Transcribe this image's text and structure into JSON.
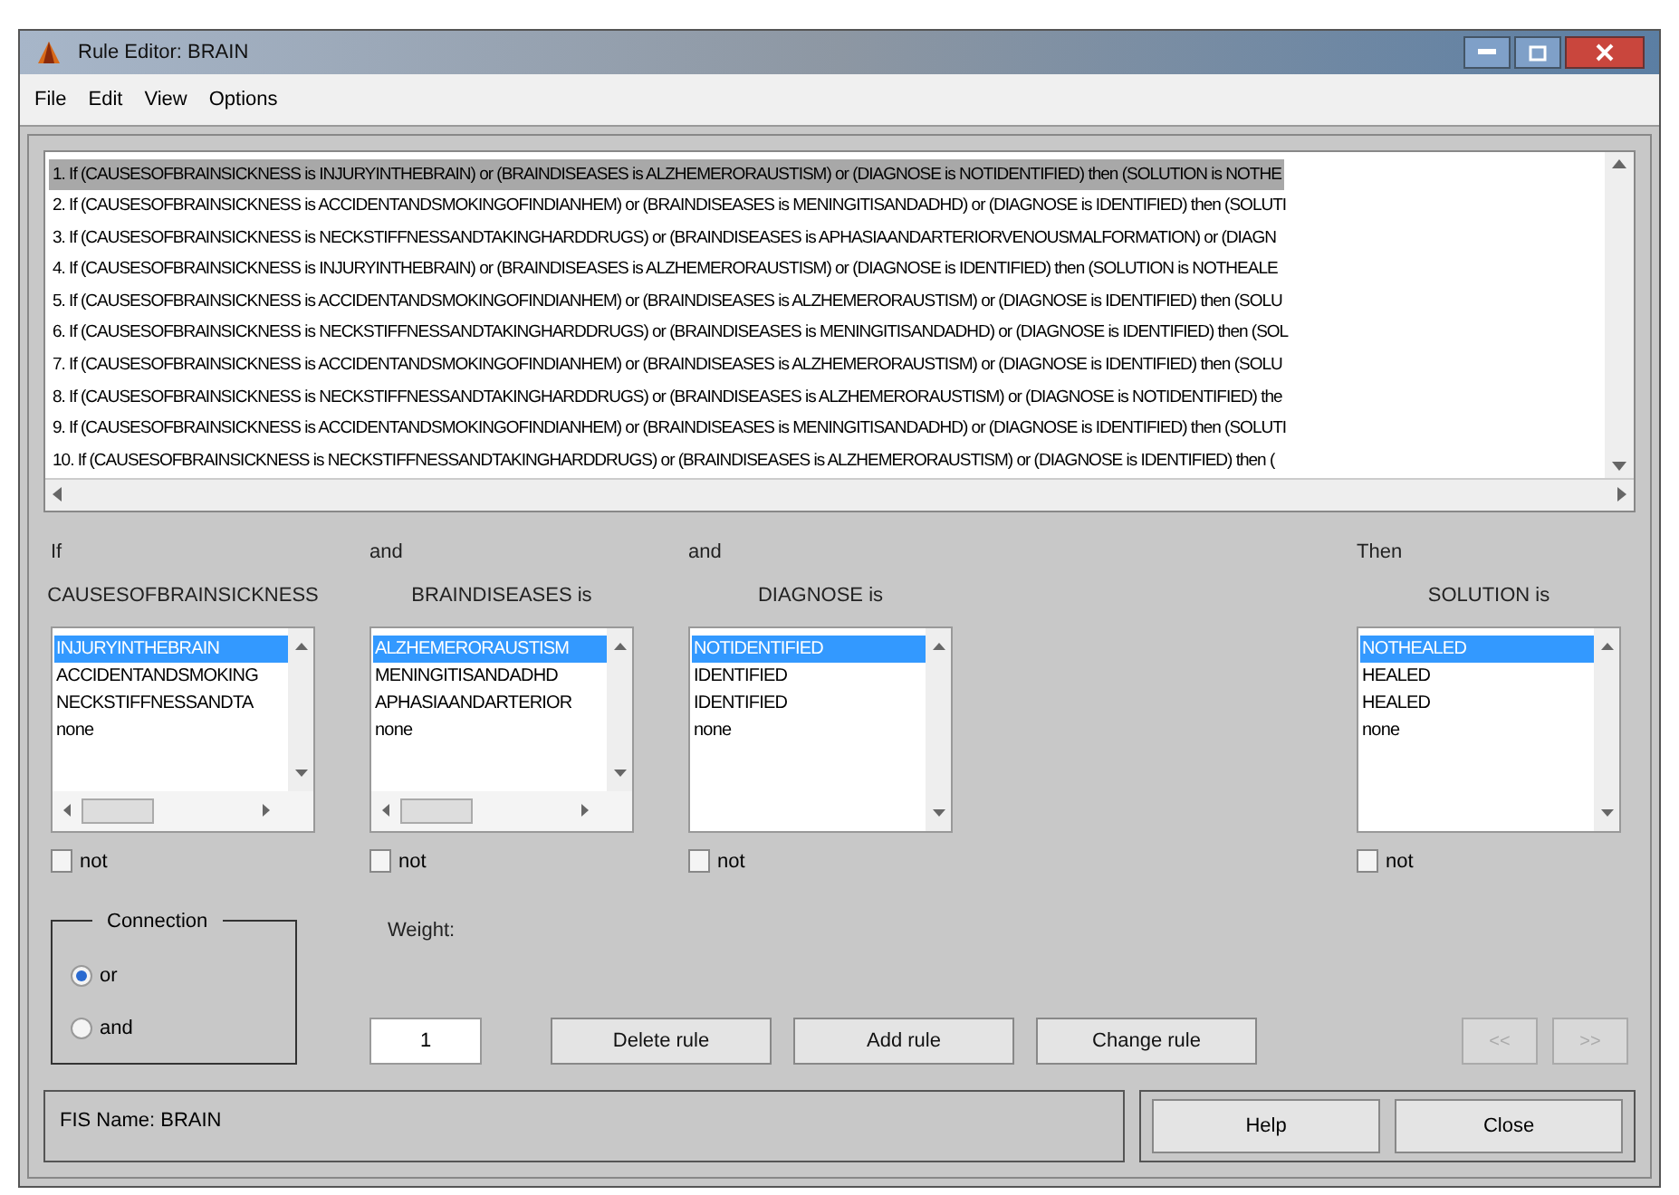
{
  "window": {
    "title": "Rule Editor: BRAIN"
  },
  "menu": [
    "File",
    "Edit",
    "View",
    "Options"
  ],
  "rules": [
    {
      "text": "1. If (CAUSESOFBRAINSICKNESS is INJURYINTHEBRAIN) or (BRAINDISEASES is ALZHEMERORAUSTISM) or (DIAGNOSE is NOTIDENTIFIED) then (SOLUTION is NOTHE",
      "selected": true
    },
    {
      "text": "2. If (CAUSESOFBRAINSICKNESS is ACCIDENTANDSMOKINGOFINDIANHEM) or (BRAINDISEASES is MENINGITISANDADHD) or (DIAGNOSE is IDENTIFIED) then (SOLUTI",
      "selected": false
    },
    {
      "text": "3. If (CAUSESOFBRAINSICKNESS is NECKSTIFFNESSANDTAKINGHARDDRUGS) or (BRAINDISEASES is APHASIAANDARTERIORVENOUSMALFORMATION) or (DIAGN",
      "selected": false
    },
    {
      "text": "4. If (CAUSESOFBRAINSICKNESS is INJURYINTHEBRAIN) or (BRAINDISEASES is ALZHEMERORAUSTISM) or (DIAGNOSE is IDENTIFIED) then (SOLUTION is NOTHEALE",
      "selected": false
    },
    {
      "text": "5. If (CAUSESOFBRAINSICKNESS is ACCIDENTANDSMOKINGOFINDIANHEM) or (BRAINDISEASES is ALZHEMERORAUSTISM) or (DIAGNOSE is IDENTIFIED) then (SOLU",
      "selected": false
    },
    {
      "text": "6. If (CAUSESOFBRAINSICKNESS is NECKSTIFFNESSANDTAKINGHARDDRUGS) or (BRAINDISEASES is MENINGITISANDADHD) or (DIAGNOSE is IDENTIFIED) then (SOL",
      "selected": false
    },
    {
      "text": "7. If (CAUSESOFBRAINSICKNESS is ACCIDENTANDSMOKINGOFINDIANHEM) or (BRAINDISEASES is ALZHEMERORAUSTISM) or (DIAGNOSE is IDENTIFIED) then (SOLU",
      "selected": false
    },
    {
      "text": "8. If (CAUSESOFBRAINSICKNESS is NECKSTIFFNESSANDTAKINGHARDDRUGS) or (BRAINDISEASES is ALZHEMERORAUSTISM) or (DIAGNOSE is NOTIDENTIFIED) the",
      "selected": false
    },
    {
      "text": "9. If (CAUSESOFBRAINSICKNESS is ACCIDENTANDSMOKINGOFINDIANHEM) or (BRAINDISEASES is MENINGITISANDADHD) or (DIAGNOSE is IDENTIFIED) then (SOLUTI",
      "selected": false
    },
    {
      "text": "10. If (CAUSESOFBRAINSICKNESS is NECKSTIFFNESSANDTAKINGHARDDRUGS) or (BRAINDISEASES is ALZHEMERORAUSTISM) or (DIAGNOSE is IDENTIFIED) then (",
      "selected": false
    }
  ],
  "columns": [
    {
      "kind": "input",
      "connector": "If",
      "label": "CAUSESOFBRAINSICKNESS",
      "items": [
        {
          "label": "INJURYINTHEBRAIN",
          "selected": true
        },
        {
          "label": "ACCIDENTANDSMOKING",
          "selected": false
        },
        {
          "label": "NECKSTIFFNESSANDTA",
          "selected": false
        },
        {
          "label": "none",
          "selected": false
        }
      ],
      "not_label": "not",
      "not_checked": false
    },
    {
      "kind": "input",
      "connector": "and",
      "label": "BRAINDISEASES is",
      "items": [
        {
          "label": "ALZHEMERORAUSTISM",
          "selected": true
        },
        {
          "label": "MENINGITISANDADHD",
          "selected": false
        },
        {
          "label": "APHASIAANDARTERIOR",
          "selected": false
        },
        {
          "label": "none",
          "selected": false
        }
      ],
      "not_label": "not",
      "not_checked": false
    },
    {
      "kind": "input",
      "connector": "and",
      "label": "DIAGNOSE is",
      "items": [
        {
          "label": "NOTIDENTIFIED",
          "selected": true
        },
        {
          "label": "IDENTIFIED",
          "selected": false
        },
        {
          "label": "IDENTIFIED",
          "selected": false
        },
        {
          "label": "none",
          "selected": false
        }
      ],
      "not_label": "not",
      "not_checked": false
    },
    {
      "kind": "output",
      "connector": "Then",
      "label": "SOLUTION is",
      "items": [
        {
          "label": "NOTHEALED",
          "selected": true
        },
        {
          "label": "HEALED",
          "selected": false
        },
        {
          "label": "HEALED",
          "selected": false
        },
        {
          "label": "none",
          "selected": false
        }
      ],
      "not_label": "not",
      "not_checked": false
    }
  ],
  "connection": {
    "title": "Connection",
    "options": [
      {
        "label": "or",
        "selected": true
      },
      {
        "label": "and",
        "selected": false
      }
    ]
  },
  "weight": {
    "label": "Weight:",
    "value": "1"
  },
  "actions": [
    {
      "label": "Delete rule",
      "disabled": false
    },
    {
      "label": "Add rule",
      "disabled": false
    },
    {
      "label": "Change rule",
      "disabled": false
    }
  ],
  "nav": [
    {
      "label": "<<",
      "disabled": true
    },
    {
      "label": ">>",
      "disabled": true
    }
  ],
  "status": "FIS Name: BRAIN",
  "footer_buttons": [
    "Help",
    "Close"
  ]
}
